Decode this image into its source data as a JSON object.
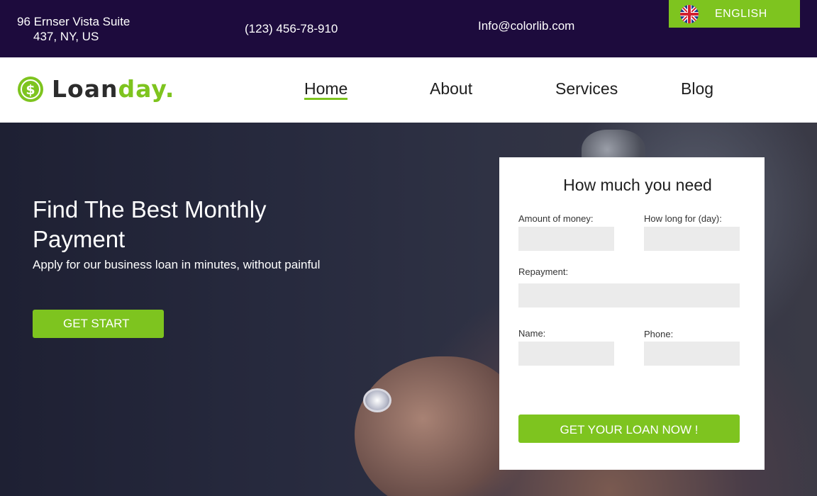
{
  "topbar": {
    "address_line1": "96 Ernser Vista Suite",
    "address_line2": "437, NY, US",
    "phone": "(123) 456-78-910",
    "email": "Info@colorlib.com",
    "language": "ENGLISH",
    "language_icon": "uk-flag-icon"
  },
  "logo": {
    "part1": "Loan",
    "part2": "day.",
    "icon": "dollar-coin-icon"
  },
  "nav": {
    "items": [
      {
        "label": "Home",
        "active": true
      },
      {
        "label": "About",
        "active": false
      },
      {
        "label": "Services",
        "active": false
      },
      {
        "label": "Blog",
        "active": false
      }
    ]
  },
  "hero": {
    "title": "Find The Best Monthly Payment",
    "subtitle": "Apply for our business loan in minutes, without painful",
    "button": "GET START"
  },
  "loan_form": {
    "title": "How much you need",
    "amount_label": "Amount of money:",
    "amount_value": "",
    "duration_label": "How long for (day):",
    "duration_value": "",
    "repayment_label": "Repayment:",
    "repayment_value": "",
    "name_label": "Name:",
    "name_value": "",
    "phone_label": "Phone:",
    "phone_value": "",
    "submit": "GET YOUR LOAN NOW !"
  },
  "colors": {
    "topbar_bg": "#1d0b3d",
    "accent": "#7ec41f"
  }
}
